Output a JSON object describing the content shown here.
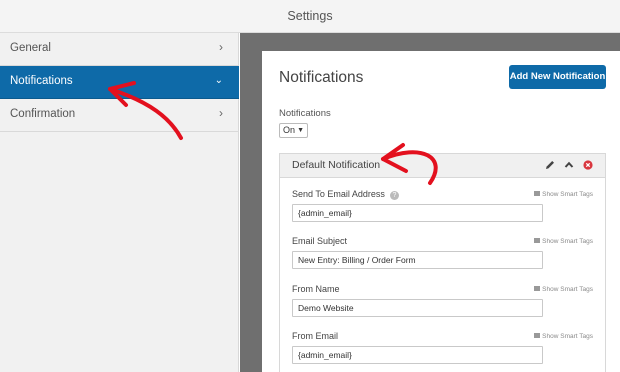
{
  "header": {
    "title": "Settings"
  },
  "sidebar": {
    "items": [
      {
        "label": "General",
        "chevron": "›"
      },
      {
        "label": "Notifications",
        "chevron": "⌄",
        "active": true
      },
      {
        "label": "Confirmation",
        "chevron": "›"
      }
    ]
  },
  "main": {
    "title": "Notifications",
    "add_button": "Add New Notification",
    "notifications_label": "Notifications",
    "notifications_select": {
      "value": "On",
      "caret": "▼"
    },
    "notification": {
      "title": "Default Notification",
      "icons": [
        "pencil-icon",
        "chevron-up-icon",
        "close-circle-icon"
      ],
      "smart_tags_label": "Show Smart Tags",
      "fields": [
        {
          "label": "Send To Email Address",
          "value": "{admin_email}",
          "help": "?"
        },
        {
          "label": "Email Subject",
          "value": "New Entry: Billing / Order Form"
        },
        {
          "label": "From Name",
          "value": "Demo Website"
        },
        {
          "label": "From Email",
          "value": "{admin_email}"
        }
      ]
    }
  },
  "colors": {
    "accent": "#0e6aa8",
    "annotation": "#e3101e",
    "content_bg": "#6f6f6f",
    "close_icon": "#d9363e"
  }
}
